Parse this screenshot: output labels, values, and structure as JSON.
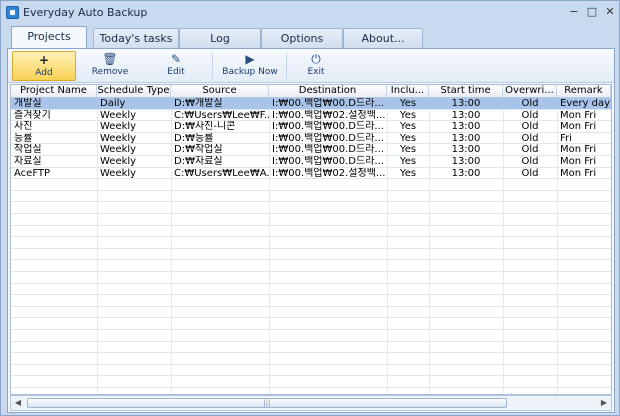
{
  "window": {
    "title": "Everyday Auto Backup"
  },
  "tabs": [
    {
      "label": "Projects",
      "active": true
    },
    {
      "label": "Today's tasks",
      "active": false
    },
    {
      "label": "Log",
      "active": false
    },
    {
      "label": "Options",
      "active": false
    },
    {
      "label": "About...",
      "active": false
    }
  ],
  "toolbar": {
    "add_label": "Add",
    "remove_label": "Remove",
    "edit_label": "Edit",
    "backup_label": "Backup Now",
    "exit_label": "Exit"
  },
  "icons": {
    "add": "plus-icon",
    "remove": "trash-icon",
    "edit": "pencil-icon",
    "backup": "play-icon",
    "exit": "power-icon"
  },
  "table": {
    "columns": [
      "Project Name",
      "Schedule Type",
      "Source",
      "Destination",
      "Inclu...",
      "Start time",
      "Overwri...",
      "Remark"
    ],
    "rows": [
      [
        "개발실",
        "Daily",
        "D:₩개발실",
        "I:₩00.백업₩00.D드라...",
        "Yes",
        "13:00",
        "Old",
        "Every day"
      ],
      [
        "즐겨찾기",
        "Weekly",
        "C:₩Users₩Lee₩F...",
        "I:₩00.백업₩02.설정백...",
        "Yes",
        "13:00",
        "Old",
        "Mon Fri"
      ],
      [
        "사진",
        "Weekly",
        "D:₩사진-니콘",
        "I:₩00.백업₩00.D드라...",
        "Yes",
        "13:00",
        "Old",
        "Mon Fri"
      ],
      [
        "능률",
        "Weekly",
        "D:₩능률",
        "I:₩00.백업₩00.D드라...",
        "Yes",
        "13:00",
        "Old",
        "Fri"
      ],
      [
        "작업실",
        "Weekly",
        "D:₩작업실",
        "I:₩00.백업₩00.D드라...",
        "Yes",
        "13:00",
        "Old",
        "Mon Fri"
      ],
      [
        "자료실",
        "Weekly",
        "D:₩자료실",
        "I:₩00.백업₩00.D드라...",
        "Yes",
        "13:00",
        "Old",
        "Mon Fri"
      ],
      [
        "AceFTP",
        "Weekly",
        "C:₩Users₩Lee₩A...",
        "I:₩00.백업₩02.설정백...",
        "Yes",
        "13:00",
        "Old",
        "Mon Fri"
      ]
    ],
    "selected_row": 0
  },
  "colors": {
    "accent": "#f8d256",
    "selection": "#a9c4ea",
    "chrome": "#c9daef"
  }
}
